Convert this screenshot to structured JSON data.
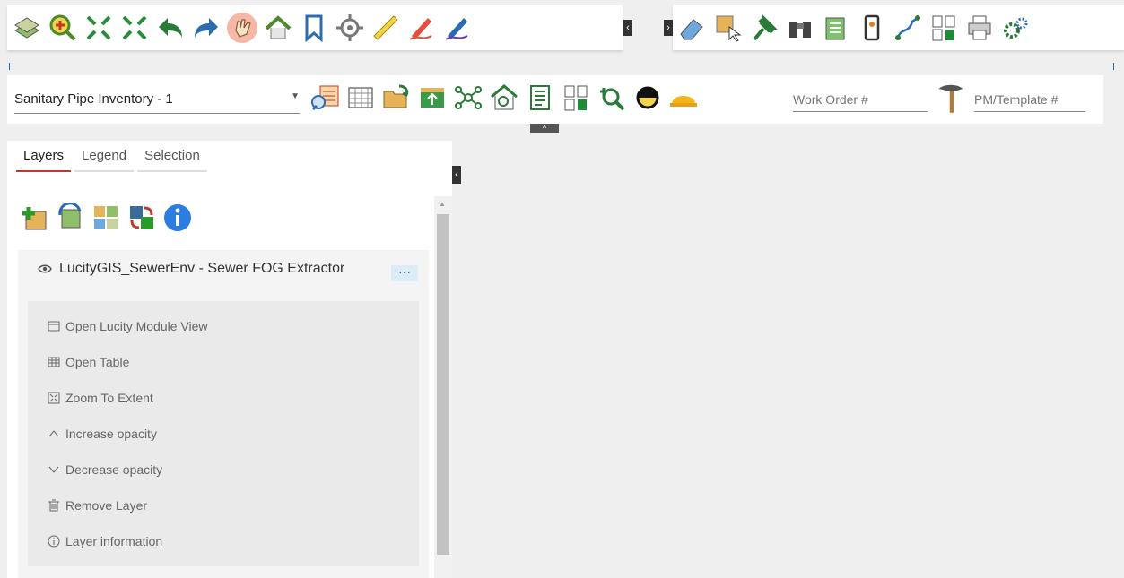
{
  "toolbar_top_left": {
    "icons": [
      "basemap-icon",
      "zoom-in-icon",
      "zoom-to-selection-icon",
      "full-extent-icon",
      "undo-icon",
      "redo-icon",
      "pan-hand-icon",
      "home-icon",
      "bookmark-icon",
      "locate-icon",
      "measure-ruler-icon",
      "draw-red-pen-icon",
      "draw-blue-pen-icon"
    ]
  },
  "toolbar_top_right": {
    "icons": [
      "eraser-icon",
      "select-features-icon",
      "pin-icon",
      "binoculars-icon",
      "layer-list-icon",
      "mobile-icon",
      "route-icon",
      "compare-icon",
      "print-icon",
      "settings-icon"
    ]
  },
  "toolbar_main": {
    "select_value": "Sanitary Pipe Inventory - 1",
    "work_order_placeholder": "Work Order #",
    "pm_template_placeholder": "PM/Template #"
  },
  "panel": {
    "tabs": [
      "Layers",
      "Legend",
      "Selection"
    ],
    "layer_title": "LucityGIS_SewerEnv - Sewer FOG Extractor",
    "dots_label": "···",
    "menu": [
      "Open Lucity Module View",
      "Open Table",
      "Zoom To Extent",
      "Increase opacity",
      "Decrease opacity",
      "Remove Layer",
      "Layer information"
    ]
  },
  "colors": {
    "accent_tab": "#c0392b",
    "hand_highlight": "#f6b7a6"
  }
}
